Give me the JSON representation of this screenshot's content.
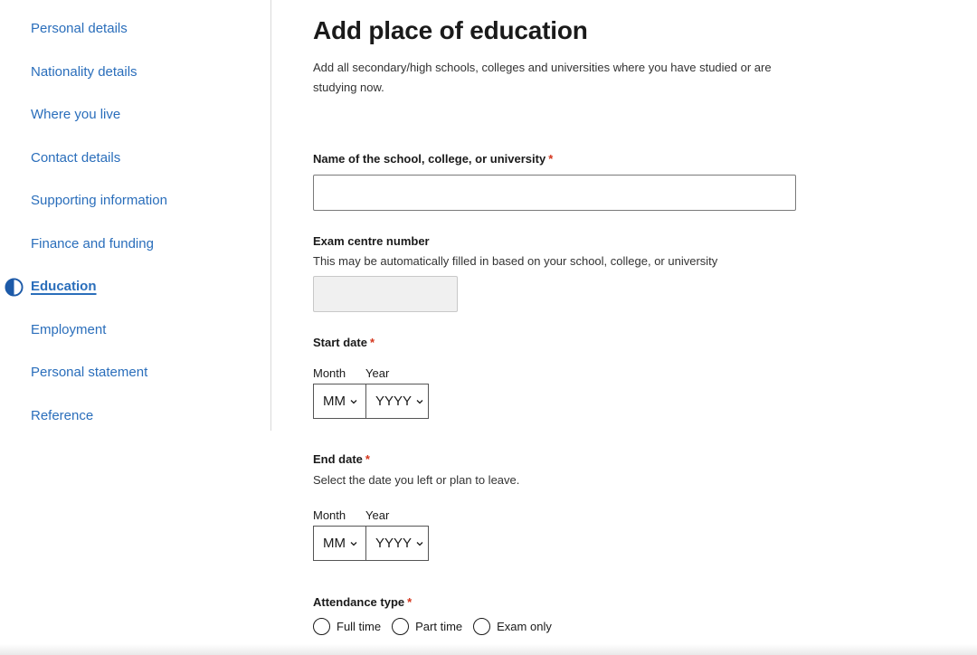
{
  "sidebar": {
    "items": [
      {
        "label": "Personal details",
        "active": false
      },
      {
        "label": "Nationality details",
        "active": false
      },
      {
        "label": "Where you live",
        "active": false
      },
      {
        "label": "Contact details",
        "active": false
      },
      {
        "label": "Supporting information",
        "active": false
      },
      {
        "label": "Finance and funding",
        "active": false
      },
      {
        "label": "Education",
        "active": true,
        "icon": "half-circle-progress-icon"
      },
      {
        "label": "Employment",
        "active": false
      },
      {
        "label": "Personal statement",
        "active": false
      },
      {
        "label": "Reference",
        "active": false
      }
    ]
  },
  "main": {
    "title": "Add place of education",
    "intro": "Add all secondary/high schools, colleges and universities where you have studied or are studying now.",
    "school": {
      "label": "Name of the school, college, or university",
      "required_marker": "*",
      "value": ""
    },
    "exam_centre": {
      "label": "Exam centre number",
      "hint": "This may be automatically filled in based on your school, college, or university",
      "value": ""
    },
    "start_date": {
      "label": "Start date",
      "required_marker": "*",
      "month_label": "Month",
      "year_label": "Year",
      "month_value": "MM",
      "year_value": "YYYY"
    },
    "end_date": {
      "label": "End date",
      "required_marker": "*",
      "hint": "Select the date you left or plan to leave.",
      "month_label": "Month",
      "year_label": "Year",
      "month_value": "MM",
      "year_value": "YYYY"
    },
    "attendance": {
      "label": "Attendance type",
      "required_marker": "*",
      "options": [
        "Full time",
        "Part time",
        "Exam only"
      ]
    }
  },
  "colors": {
    "link": "#2a6ebb",
    "required": "#d4351c",
    "text": "#1a1a1a",
    "readonly_bg": "#f0f0f0"
  }
}
